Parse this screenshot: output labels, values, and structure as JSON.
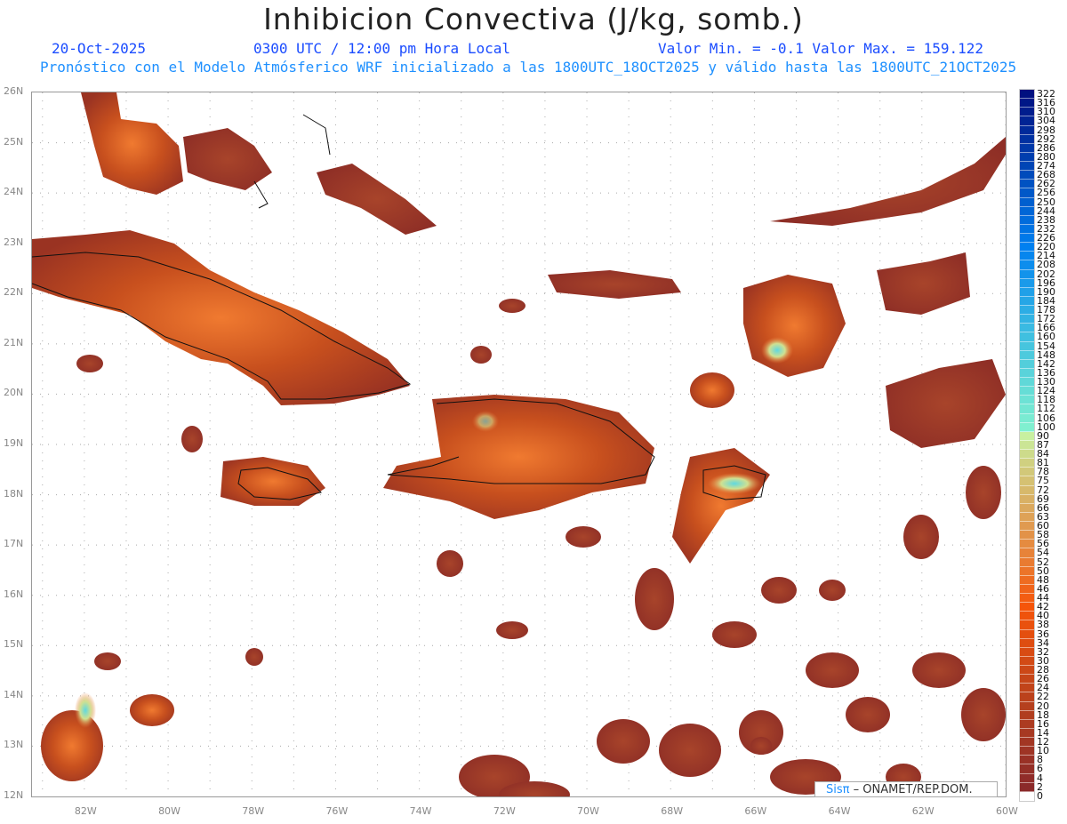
{
  "header": {
    "title": "Inhibicion Convectiva (J/kg, somb.)",
    "date": "20-Oct-2025",
    "time": "0300 UTC / 12:00 pm Hora Local",
    "min_max": "Valor Min. = -0.1  Valor Max. = 159.122",
    "subtitle": "Pronóstico con el Modelo Atmósferico WRF inicializado a las 1800UTC_18OCT2025 y válido hasta las  1800UTC_21OCT2025"
  },
  "map": {
    "lat_labels": [
      "26N",
      "25N",
      "24N",
      "23N",
      "22N",
      "21N",
      "20N",
      "19N",
      "18N",
      "17N",
      "16N",
      "15N",
      "14N",
      "13N",
      "12N"
    ],
    "lon_labels": [
      "82W",
      "80W",
      "78W",
      "76W",
      "74W",
      "72W",
      "70W",
      "68W",
      "66W",
      "64W",
      "62W",
      "60W"
    ],
    "lat_range": [
      12,
      26
    ],
    "lon_range": [
      -83.25,
      -60
    ]
  },
  "colorbar": {
    "labels": [
      "322",
      "316",
      "310",
      "304",
      "298",
      "292",
      "286",
      "280",
      "274",
      "268",
      "262",
      "256",
      "250",
      "244",
      "238",
      "232",
      "226",
      "220",
      "214",
      "208",
      "202",
      "196",
      "190",
      "184",
      "178",
      "172",
      "166",
      "160",
      "154",
      "148",
      "142",
      "136",
      "130",
      "124",
      "118",
      "112",
      "106",
      "100",
      "90",
      "87",
      "84",
      "81",
      "78",
      "75",
      "72",
      "69",
      "66",
      "63",
      "60",
      "58",
      "56",
      "54",
      "52",
      "50",
      "48",
      "46",
      "44",
      "42",
      "40",
      "38",
      "36",
      "34",
      "32",
      "30",
      "28",
      "26",
      "24",
      "22",
      "20",
      "18",
      "16",
      "14",
      "12",
      "10",
      "8",
      "6",
      "4",
      "2",
      "0"
    ],
    "colors": {
      "zero": "#ffffff",
      "low": "#8b2a2a",
      "mid": "#f25a0a",
      "high": "#c8f0a0",
      "cyan": "#60e0d0",
      "top": "#001080"
    }
  },
  "credit": {
    "logo": "Sisπ",
    "text": " – ONAMET/REP.DOM."
  }
}
